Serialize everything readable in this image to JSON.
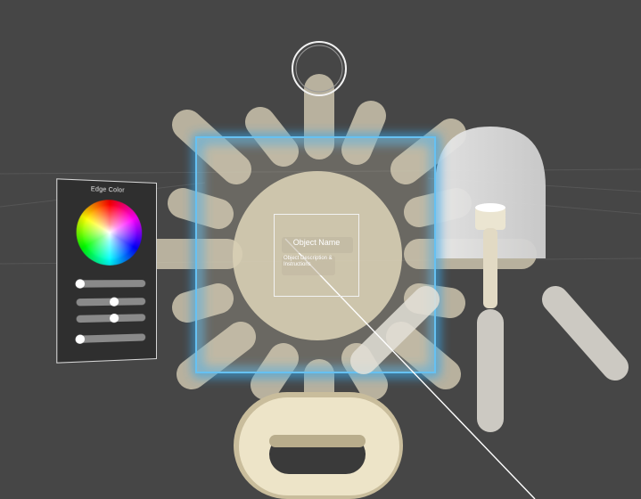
{
  "edge_panel": {
    "title": "Edge Color",
    "sliders": [
      {
        "name": "slider-1",
        "value": 0.0
      },
      {
        "name": "slider-2",
        "value": 0.55
      },
      {
        "name": "slider-3",
        "value": 0.55
      },
      {
        "name": "slider-4",
        "value": 0.0
      }
    ]
  },
  "object_card": {
    "name": "Object Name",
    "description": "Object Description & Instructions"
  },
  "colors": {
    "background": "#464646",
    "object_cream": "#e6dfca",
    "selection_glow": "#3aa6e6",
    "wireframe": "#ffffff"
  }
}
